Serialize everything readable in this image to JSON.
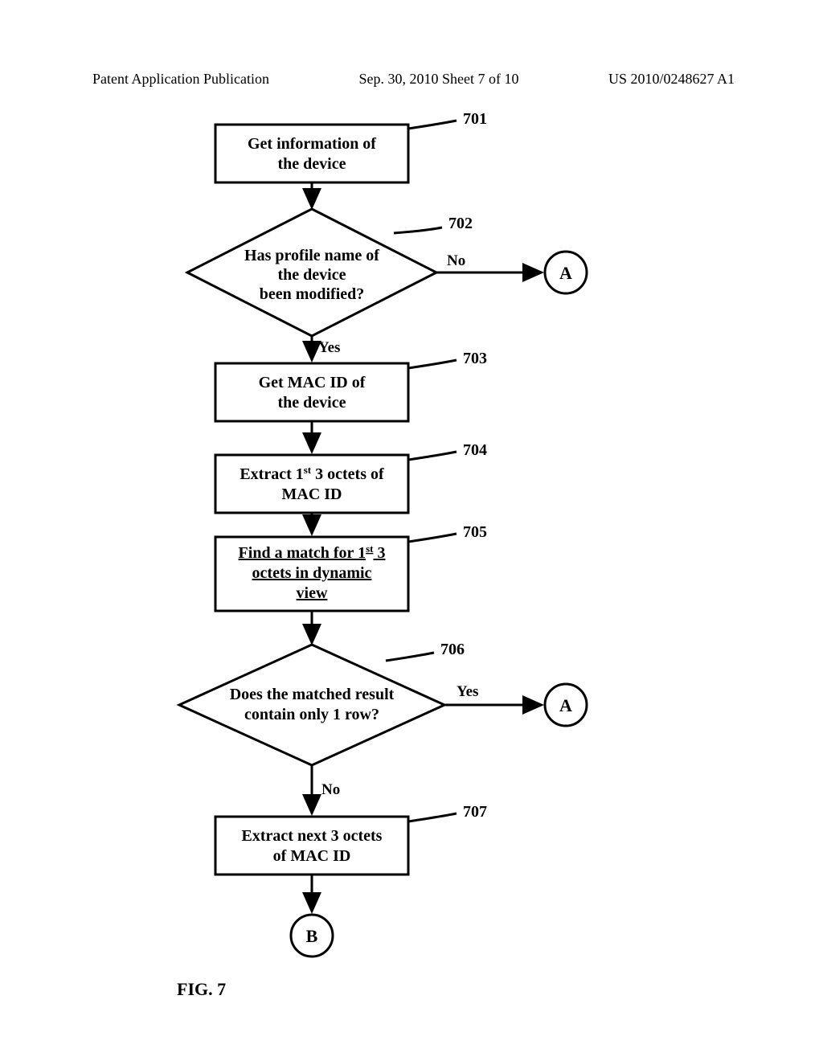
{
  "header": {
    "left": "Patent Application Publication",
    "center": "Sep. 30, 2010  Sheet 7 of 10",
    "right": "US 2010/0248627 A1"
  },
  "nodes": {
    "n701": {
      "ref": "701",
      "line1": "Get information of",
      "line2": "the device"
    },
    "n702": {
      "ref": "702",
      "line1": "Has profile name of",
      "line2": "the device",
      "line3": "been modified?",
      "no": "No",
      "yes": "Yes"
    },
    "n703": {
      "ref": "703",
      "line1": "Get MAC ID  of",
      "line2": "the device"
    },
    "n704": {
      "ref": "704",
      "line1_a": "Extract 1",
      "line1_b": "st",
      "line1_c": " 3 octets of",
      "line2": "MAC ID"
    },
    "n705": {
      "ref": "705",
      "line1_a": "Find a match for 1",
      "line1_b": "st",
      "line1_c": " 3",
      "line2": "octets in dynamic",
      "line3": "view"
    },
    "n706": {
      "ref": "706",
      "line1": "Does the matched result",
      "line2": "contain only 1 row?",
      "yes": "Yes",
      "no": "No"
    },
    "n707": {
      "ref": "707",
      "line1": "Extract next 3 octets",
      "line2": "of MAC ID"
    }
  },
  "connectors": {
    "a": "A",
    "b": "B"
  },
  "figure": "FIG. 7"
}
